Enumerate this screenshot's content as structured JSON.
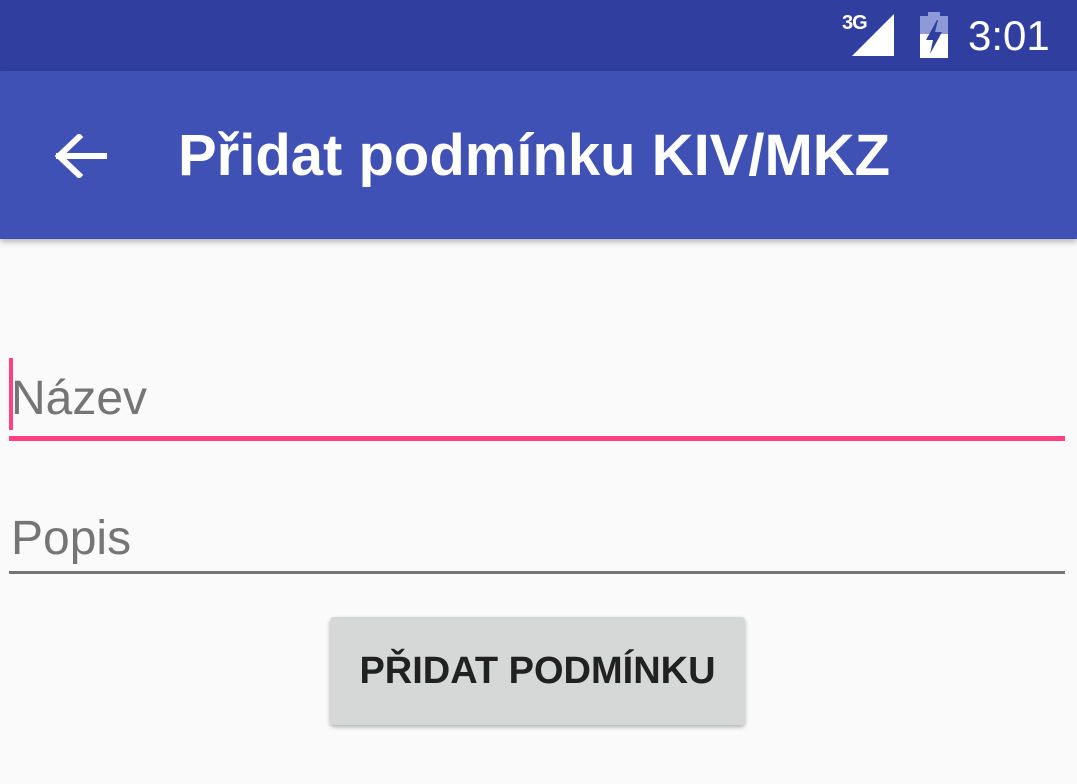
{
  "status_bar": {
    "network_label": "3G",
    "time": "3:01",
    "icons": [
      "signal-icon",
      "battery-charging-icon"
    ],
    "background_color": "#303f9f"
  },
  "app_bar": {
    "back_icon": "arrow-back-icon",
    "title": "Přidat podmínku KIV/MKZ",
    "background_color": "#3f51b5"
  },
  "form": {
    "name_field": {
      "placeholder": "Název",
      "value": "",
      "focused": true,
      "accent_color": "#ff4081"
    },
    "description_field": {
      "placeholder": "Popis",
      "value": "",
      "focused": false
    },
    "submit_label": "PŘIDAT PODMÍNKU"
  }
}
